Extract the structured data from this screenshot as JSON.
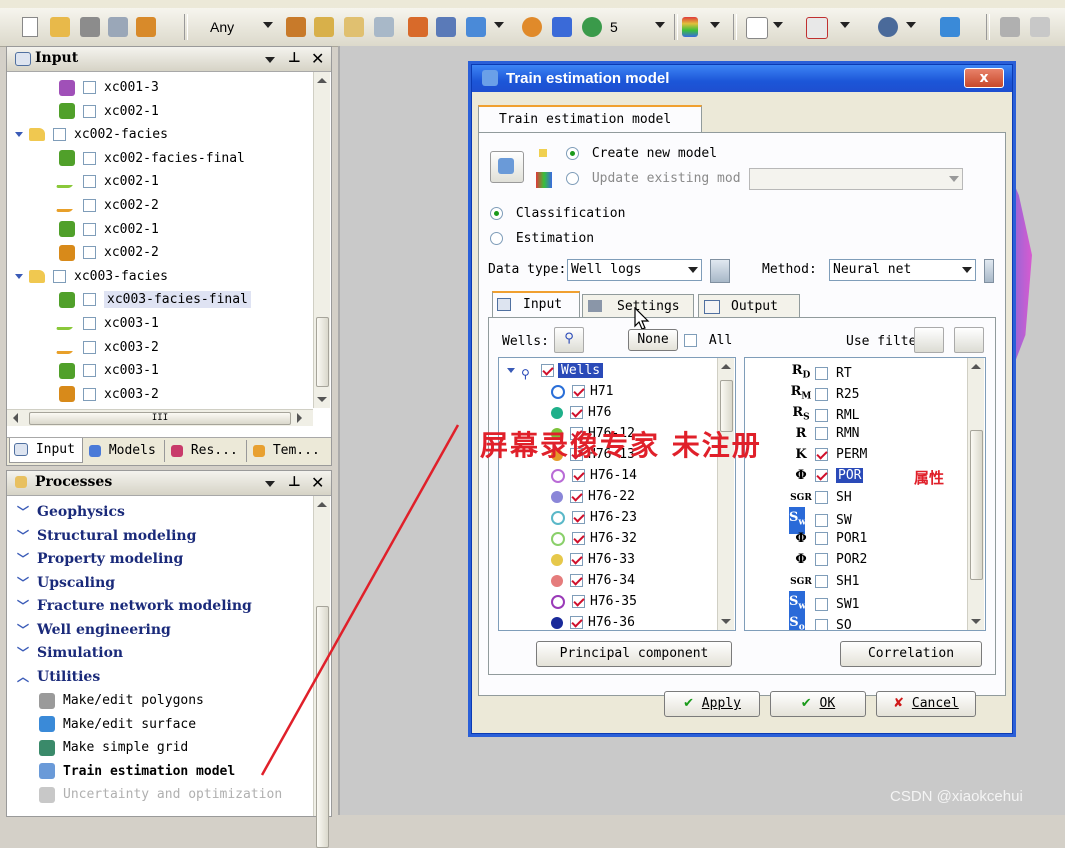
{
  "toolbar": {
    "any_label": "Any",
    "count_label": "5"
  },
  "input_panel": {
    "title": "Input",
    "tree": [
      {
        "label": "xc001-3",
        "indent": 2,
        "icon": "grid-purple-icon",
        "checked": false
      },
      {
        "label": "xc002-1",
        "indent": 2,
        "icon": "grid-green-icon",
        "checked": false
      },
      {
        "label": "xc002-facies",
        "indent": 1,
        "icon": "folder-icon",
        "checked": false
      },
      {
        "label": "xc002-facies-final",
        "indent": 2,
        "icon": "grid-green-icon",
        "checked": false
      },
      {
        "label": "xc002-1",
        "indent": 2,
        "icon": "seismic-green-icon",
        "checked": false
      },
      {
        "label": "xc002-2",
        "indent": 2,
        "icon": "seismic-orange-icon",
        "checked": false
      },
      {
        "label": "xc002-1",
        "indent": 2,
        "icon": "grid-green-icon",
        "checked": false
      },
      {
        "label": "xc002-2",
        "indent": 2,
        "icon": "grid-orange-icon",
        "checked": false
      },
      {
        "label": "xc003-facies",
        "indent": 1,
        "icon": "folder-icon",
        "checked": false
      },
      {
        "label": "xc003-facies-final",
        "indent": 2,
        "icon": "grid-green-icon",
        "checked": false,
        "selected": true
      },
      {
        "label": "xc003-1",
        "indent": 2,
        "icon": "seismic-green-icon",
        "checked": false
      },
      {
        "label": "xc003-2",
        "indent": 2,
        "icon": "seismic-orange-icon",
        "checked": false
      },
      {
        "label": "xc003-1",
        "indent": 2,
        "icon": "grid-green-icon",
        "checked": false
      },
      {
        "label": "xc003-2",
        "indent": 2,
        "icon": "grid-orange-icon",
        "checked": false
      }
    ],
    "hscroll_label": "III",
    "bottom_tabs": [
      "Input",
      "Models",
      "Res...",
      "Tem..."
    ]
  },
  "processes_panel": {
    "title": "Processes",
    "groups": [
      "Geophysics",
      "Structural modeling",
      "Property modeling",
      "Upscaling",
      "Fracture network modeling",
      "Well engineering",
      "Simulation",
      "Utilities"
    ],
    "utilities": [
      {
        "label": "Make/edit polygons",
        "enabled": true
      },
      {
        "label": "Make/edit surface",
        "enabled": true
      },
      {
        "label": "Make simple grid",
        "enabled": true
      },
      {
        "label": "Train estimation model",
        "enabled": true,
        "active": true
      },
      {
        "label": "Uncertainty and optimization",
        "enabled": false
      }
    ]
  },
  "dialog": {
    "title": "Train estimation model",
    "close_label": "x",
    "main_tab": "Train estimation model",
    "create_new": "Create new model",
    "update_existing": "Update existing mod",
    "classification": "Classification",
    "estimation": "Estimation",
    "data_type_label": "Data type:",
    "data_type_value": "Well logs",
    "method_label": "Method:",
    "method_value": "Neural net",
    "tabs": [
      "Input",
      "Settings",
      "Output"
    ],
    "wells_label": "Wells:",
    "none_button": "None",
    "all_label": "All",
    "use_filter_label": "Use filte",
    "wells_root": "Wells",
    "wells": [
      {
        "name": "H71",
        "icon": "well-blue-icon",
        "color": "#2a6fd8"
      },
      {
        "name": "H76",
        "icon": "dot-teal-icon",
        "color": "#1fb08a"
      },
      {
        "name": "H76-12",
        "icon": "dot-green-icon",
        "color": "#7cc23a"
      },
      {
        "name": "H76-13",
        "icon": "dot-orange-icon",
        "color": "#e59a2a"
      },
      {
        "name": "H76-14",
        "icon": "well-violet-icon",
        "color": "#b96bd6"
      },
      {
        "name": "H76-22",
        "icon": "dot-lavender-icon",
        "color": "#8a86d8"
      },
      {
        "name": "H76-23",
        "icon": "well-cyan-icon",
        "color": "#5ab8c8"
      },
      {
        "name": "H76-32",
        "icon": "well-lightgreen-icon",
        "color": "#8ad06a"
      },
      {
        "name": "H76-33",
        "icon": "dot-yellow-icon",
        "color": "#e6c84a"
      },
      {
        "name": "H76-34",
        "icon": "dot-salmon-icon",
        "color": "#e57c7c"
      },
      {
        "name": "H76-35",
        "icon": "well-purple-icon",
        "color": "#9a3ab8"
      },
      {
        "name": "H76-36",
        "icon": "dot-navy-icon",
        "color": "#1a2a9a"
      }
    ],
    "properties": [
      {
        "symbol": "R",
        "sub": "D",
        "name": "RT",
        "checked": false
      },
      {
        "symbol": "R",
        "sub": "M",
        "name": "R25",
        "checked": false
      },
      {
        "symbol": "R",
        "sub": "S",
        "name": "RML",
        "checked": false
      },
      {
        "symbol": "R",
        "sub": "",
        "name": "RMN",
        "checked": false
      },
      {
        "symbol": "K",
        "sub": "",
        "name": "PERM",
        "checked": true
      },
      {
        "symbol": "Φ",
        "sub": "",
        "name": "POR",
        "checked": true,
        "selected": true
      },
      {
        "symbol": "SGR",
        "sub": "",
        "name": "SH",
        "checked": false
      },
      {
        "symbol": "S",
        "sub": "w",
        "name": "SW",
        "checked": false
      },
      {
        "symbol": "Φ",
        "sub": "",
        "name": "POR1",
        "checked": false
      },
      {
        "symbol": "Φ",
        "sub": "",
        "name": "POR2",
        "checked": false
      },
      {
        "symbol": "SGR",
        "sub": "",
        "name": "SH1",
        "checked": false
      },
      {
        "symbol": "S",
        "sub": "w",
        "name": "SW1",
        "checked": false
      },
      {
        "symbol": "S",
        "sub": "o",
        "name": "SO",
        "checked": false
      }
    ],
    "principal_button": "Principal component",
    "correlation_button": "Correlation",
    "apply_button": "Apply",
    "ok_button": "OK",
    "cancel_button": "Cancel"
  },
  "overlay": {
    "watermark": "屏幕录像专家 未注册",
    "annotation": "属性",
    "credit": "CSDN @xiaokcehui"
  },
  "colors": {
    "accent_red": "#e0202a",
    "title_blue": "#1c56d8",
    "process_text": "#1a2a7a"
  }
}
